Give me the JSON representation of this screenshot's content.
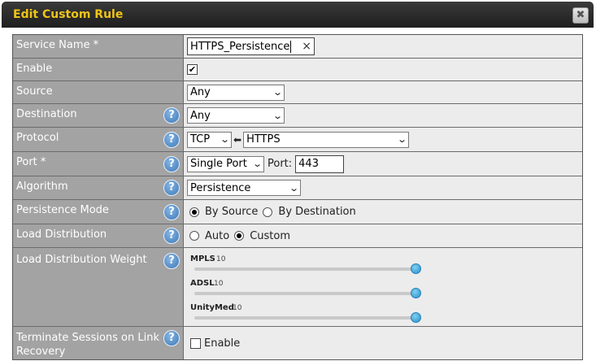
{
  "dialog": {
    "title": "Edit Custom Rule",
    "close_label": "✖"
  },
  "fields": {
    "service_name": {
      "label": "Service Name *",
      "value": "HTTPS_Persistence",
      "clear": "×"
    },
    "enable": {
      "label": "Enable",
      "checked": true,
      "mark": "✔"
    },
    "source": {
      "label": "Source",
      "value": "Any"
    },
    "destination": {
      "label": "Destination",
      "value": "Any"
    },
    "protocol": {
      "label": "Protocol",
      "value": "TCP",
      "arrow": "🡐",
      "preset": "HTTPS"
    },
    "port": {
      "label": "Port *",
      "mode": "Single Port",
      "port_label": "Port:",
      "port_value": "443"
    },
    "algorithm": {
      "label": "Algorithm",
      "value": "Persistence"
    },
    "persistence_mode": {
      "label": "Persistence Mode",
      "options": [
        "By Source",
        "By Destination"
      ],
      "selected": "By Source"
    },
    "load_distribution": {
      "label": "Load Distribution",
      "options": [
        "Auto",
        "Custom"
      ],
      "selected": "Custom"
    },
    "load_distribution_weight": {
      "label": "Load Distribution Weight",
      "sliders": [
        {
          "name": "MPLS",
          "value": "10",
          "level": 1.0
        },
        {
          "name": "ADSL",
          "value": "10",
          "level": 1.0
        },
        {
          "name": "UnityMed",
          "value": "10",
          "level": 1.0
        }
      ]
    },
    "terminate_sessions": {
      "label": "Terminate Sessions on Link Recovery",
      "checkbox_label": "Enable",
      "checked": false
    }
  },
  "help_glyph": "?",
  "colors": {
    "title": "#f0c419",
    "label_bg": "#a3a3a3",
    "value_bg": "#ececec",
    "help": "#3d79b8",
    "knob": "#2b8fc9"
  }
}
